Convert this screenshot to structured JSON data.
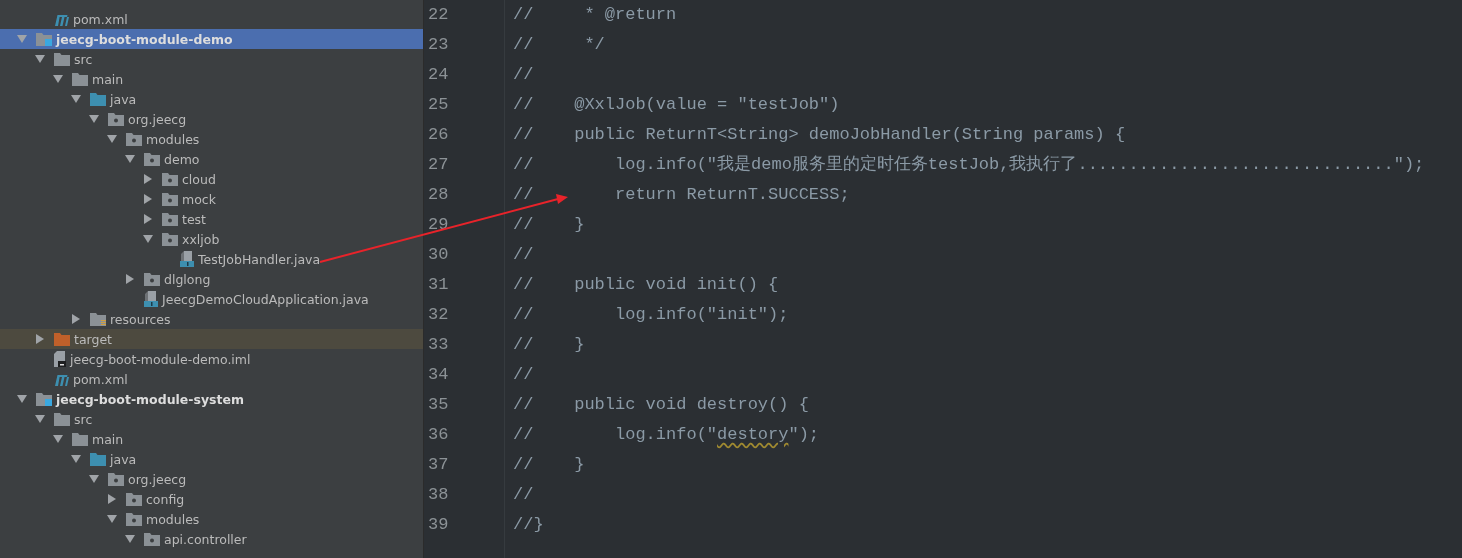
{
  "tree": {
    "leading_items": [
      {
        "name": "pom.xml",
        "kind": "maven",
        "selected": false,
        "highlighted": false
      }
    ],
    "items": [
      {
        "name": "jeecg-boot-module-demo",
        "kind": "module",
        "selected": true,
        "highlighted": false,
        "expanded": true,
        "children": [
          {
            "name": "src",
            "kind": "folder",
            "selected": false,
            "highlighted": false,
            "expanded": true,
            "children": [
              {
                "name": "main",
                "kind": "folder",
                "selected": false,
                "highlighted": false,
                "expanded": true,
                "children": [
                  {
                    "name": "java",
                    "kind": "source-folder",
                    "selected": false,
                    "highlighted": false,
                    "expanded": true,
                    "children": [
                      {
                        "name": "org.jeecg",
                        "kind": "package",
                        "selected": false,
                        "highlighted": false,
                        "expanded": true,
                        "children": [
                          {
                            "name": "modules",
                            "kind": "package",
                            "selected": false,
                            "highlighted": false,
                            "expanded": true,
                            "children": [
                              {
                                "name": "demo",
                                "kind": "package",
                                "selected": false,
                                "highlighted": false,
                                "expanded": true,
                                "children": [
                                  {
                                    "name": "cloud",
                                    "kind": "package",
                                    "selected": false,
                                    "highlighted": false,
                                    "expanded": false
                                  },
                                  {
                                    "name": "mock",
                                    "kind": "package",
                                    "selected": false,
                                    "highlighted": false,
                                    "expanded": false
                                  },
                                  {
                                    "name": "test",
                                    "kind": "package",
                                    "selected": false,
                                    "highlighted": false,
                                    "expanded": false
                                  },
                                  {
                                    "name": "xxljob",
                                    "kind": "package",
                                    "selected": false,
                                    "highlighted": false,
                                    "expanded": true,
                                    "children": [
                                      {
                                        "name": "TestJobHandler.java",
                                        "kind": "java",
                                        "selected": false,
                                        "highlighted": false
                                      }
                                    ]
                                  }
                                ]
                              },
                              {
                                "name": "dlglong",
                                "kind": "package",
                                "selected": false,
                                "highlighted": false,
                                "expanded": false
                              },
                              {
                                "name": "JeecgDemoCloudApplication.java",
                                "kind": "java",
                                "selected": false,
                                "highlighted": false
                              }
                            ]
                          }
                        ]
                      }
                    ]
                  },
                  {
                    "name": "resources",
                    "kind": "resources",
                    "selected": false,
                    "highlighted": false,
                    "expanded": false
                  }
                ]
              }
            ]
          },
          {
            "name": "target",
            "kind": "excluded",
            "selected": false,
            "highlighted": true,
            "expanded": false
          },
          {
            "name": "jeecg-boot-module-demo.iml",
            "kind": "iml",
            "selected": false,
            "highlighted": false
          },
          {
            "name": "pom.xml",
            "kind": "maven",
            "selected": false,
            "highlighted": false
          }
        ]
      },
      {
        "name": "jeecg-boot-module-system",
        "kind": "module",
        "selected": false,
        "highlighted": false,
        "expanded": true,
        "children": [
          {
            "name": "src",
            "kind": "folder",
            "selected": false,
            "highlighted": false,
            "expanded": true,
            "children": [
              {
                "name": "main",
                "kind": "folder",
                "selected": false,
                "highlighted": false,
                "expanded": true,
                "children": [
                  {
                    "name": "java",
                    "kind": "source-folder",
                    "selected": false,
                    "highlighted": false,
                    "expanded": true,
                    "children": [
                      {
                        "name": "org.jeecg",
                        "kind": "package",
                        "selected": false,
                        "highlighted": false,
                        "expanded": true,
                        "children": [
                          {
                            "name": "config",
                            "kind": "package",
                            "selected": false,
                            "highlighted": false,
                            "expanded": false
                          },
                          {
                            "name": "modules",
                            "kind": "package",
                            "selected": false,
                            "highlighted": false,
                            "expanded": true,
                            "children": [
                              {
                                "name": "api.controller",
                                "kind": "package",
                                "selected": false,
                                "highlighted": false,
                                "expanded": true
                              }
                            ]
                          }
                        ]
                      }
                    ]
                  }
                ]
              }
            ]
          }
        ]
      }
    ]
  },
  "editor": {
    "lines": [
      {
        "number": "22",
        "text": "//     * @return"
      },
      {
        "number": "23",
        "text": "//     */"
      },
      {
        "number": "24",
        "text": "//"
      },
      {
        "number": "25",
        "text": "//    @XxlJob(value = \"testJob\")"
      },
      {
        "number": "26",
        "text": "//    public ReturnT<String> demoJobHandler(String params) {"
      },
      {
        "number": "27",
        "text": "//        log.info(\"我是demo服务里的定时任务testJob,我执行了...............................\");"
      },
      {
        "number": "28",
        "text": "//        return ReturnT.SUCCESS;"
      },
      {
        "number": "29",
        "text": "//    }"
      },
      {
        "number": "30",
        "text": "//"
      },
      {
        "number": "31",
        "text": "//    public void init() {"
      },
      {
        "number": "32",
        "text": "//        log.info(\"init\");"
      },
      {
        "number": "33",
        "text": "//    }"
      },
      {
        "number": "34",
        "text": "//"
      },
      {
        "number": "35",
        "text": "//    public void destroy() {"
      },
      {
        "number": "36",
        "segments": [
          {
            "text": "//        log.info(\"",
            "typo": false
          },
          {
            "text": "destory",
            "typo": true
          },
          {
            "text": "\");",
            "typo": false
          }
        ]
      },
      {
        "number": "37",
        "text": "//    }"
      },
      {
        "number": "38",
        "text": "//"
      },
      {
        "number": "39",
        "text": "//}"
      }
    ]
  }
}
